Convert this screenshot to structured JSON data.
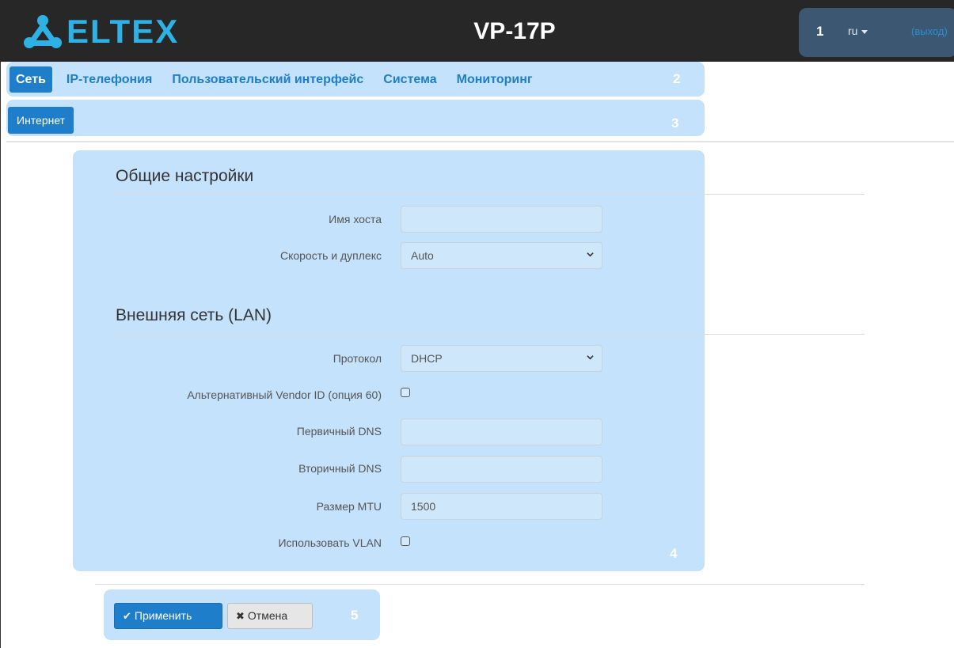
{
  "header": {
    "logo_text": "ELTEX",
    "device": "VP-17P",
    "marker": "1",
    "language": "ru",
    "logout": "(выход)"
  },
  "nav": {
    "items": [
      "Сеть",
      "IP-телефония",
      "Пользовательский интерфейс",
      "Система",
      "Мониторинг"
    ],
    "marker": "2"
  },
  "subnav": {
    "items": [
      "Интернет"
    ],
    "marker": "3"
  },
  "form": {
    "marker": "4",
    "general": {
      "title": "Общие настройки",
      "hostname_label": "Имя хоста",
      "hostname_value": "",
      "speed_label": "Скорость и дуплекс",
      "speed_value": "Auto"
    },
    "lan": {
      "title": "Внешняя сеть (LAN)",
      "protocol_label": "Протокол",
      "protocol_value": "DHCP",
      "vendor_label": "Альтернативный Vendor ID (опция 60)",
      "vendor_checked": false,
      "dns1_label": "Первичный DNS",
      "dns1_value": "",
      "dns2_label": "Вторичный DNS",
      "dns2_value": "",
      "mtu_label": "Размер MTU",
      "mtu_value": "1500",
      "vlan_label": "Использовать VLAN",
      "vlan_checked": false
    }
  },
  "actions": {
    "apply": "Применить",
    "cancel": "Отмена",
    "marker": "5"
  },
  "colors": {
    "header_bg": "#272727",
    "accent": "#1f7ec9",
    "brand": "#2eb2e6",
    "highlight": "#a0d0f8"
  }
}
